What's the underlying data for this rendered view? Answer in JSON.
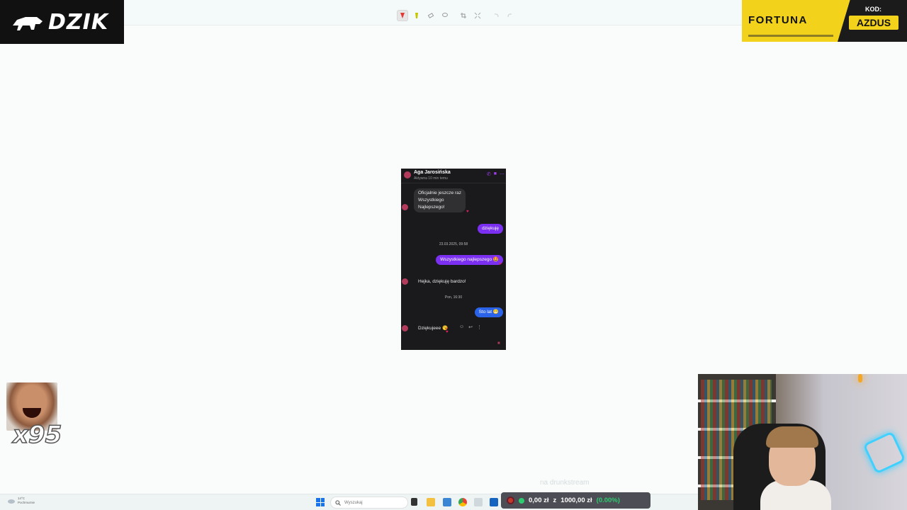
{
  "overlay": {
    "logo_text": "DZIK",
    "sponsor_name": "FORTUNA",
    "sponsor_code_label": "KOD:",
    "sponsor_code": "AZDUS",
    "emote_count": "x95",
    "faint_caption": "na drunkstream"
  },
  "toolbar": {
    "tools": [
      "highlighter-icon",
      "marker-icon",
      "eraser-icon",
      "lasso-icon",
      "crop-icon",
      "shrink-icon",
      "undo-icon",
      "redo-icon"
    ]
  },
  "phone": {
    "contact_name": "Aga Jarosińska",
    "contact_status": "Aktywna 10 min temu",
    "messages": [
      {
        "side": "in",
        "text_lines": [
          "Oficjalnie jeszcze raz",
          "Wszystkiego",
          "Najlepszego!"
        ]
      },
      {
        "side": "out",
        "text": "dziękuję"
      },
      {
        "side": "stamp",
        "text": "23.03.2025, 09:58"
      },
      {
        "side": "out",
        "text": "Wszystkiego najlepszego 🤩"
      },
      {
        "side": "in",
        "text": "Hejka, dziękuję bardzo!"
      },
      {
        "side": "stamp",
        "text": "Pon, 16:30"
      },
      {
        "side": "out",
        "text": "Sto lat 😁"
      },
      {
        "side": "in",
        "text": "Dziękujeee 😘"
      }
    ]
  },
  "taskbar": {
    "weather_temp": "14°C",
    "weather_desc": "Pochmurnie",
    "search_placeholder": "Wyszukaj",
    "balance_text": "0,00 zł",
    "balance_sep": "z",
    "balance_total": "1000,00 zł",
    "balance_percent": "(0.00%)"
  }
}
